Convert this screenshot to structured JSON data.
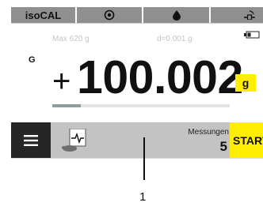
{
  "status_bar": {
    "app_label": "isoCAL",
    "icons": [
      "level-target-icon",
      "drop-icon",
      "connection-icon"
    ]
  },
  "weighing": {
    "max_capacity": "Max 620 g",
    "readability": "d=0.001 g",
    "mode_indicator": "G",
    "sign": "+",
    "value": "100.002",
    "unit": "g",
    "capacity_used_fraction": 0.16
  },
  "toolbar": {
    "count_label": "Messungen",
    "count_value": "5",
    "start_label": "START"
  },
  "callout": {
    "number": "1"
  },
  "colors": {
    "accent_yellow": "#ffee00",
    "status_bar_gray": "#8f8f8f",
    "toolbar_gray": "#c3c3c3",
    "menu_dark": "#262626"
  }
}
